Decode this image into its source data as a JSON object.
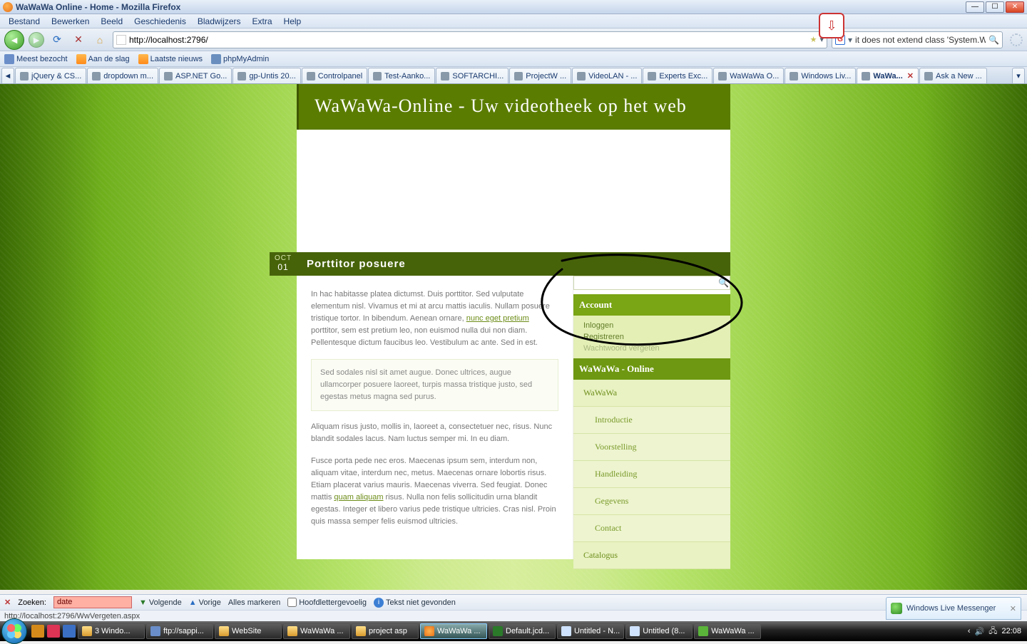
{
  "window": {
    "title": "WaWaWa Online - Home - Mozilla Firefox"
  },
  "menus": {
    "bestand": "Bestand",
    "bewerken": "Bewerken",
    "beeld": "Beeld",
    "geschiedenis": "Geschiedenis",
    "bladwijzers": "Bladwijzers",
    "extra": "Extra",
    "help": "Help"
  },
  "url": "http://localhost:2796/",
  "search_box": "it does not extend class 'System.Web.UI.Page'.",
  "bookmarks": {
    "a": "Meest bezocht",
    "b": "Aan de slag",
    "c": "Laatste nieuws",
    "d": "phpMyAdmin"
  },
  "tabs": [
    {
      "label": "jQuery & CS..."
    },
    {
      "label": "dropdown m..."
    },
    {
      "label": "ASP.NET Go..."
    },
    {
      "label": "gp-Untis 20..."
    },
    {
      "label": "Controlpanel"
    },
    {
      "label": "Test-Aanko..."
    },
    {
      "label": "SOFTARCHI..."
    },
    {
      "label": "ProjectW ..."
    },
    {
      "label": "VideoLAN - ..."
    },
    {
      "label": "Experts Exc..."
    },
    {
      "label": "WaWaWa O..."
    },
    {
      "label": "Windows Liv..."
    },
    {
      "label": "WaWa...",
      "active": true,
      "close": true
    },
    {
      "label": "Ask a New ..."
    }
  ],
  "page": {
    "header": "WaWaWa-Online - Uw videotheek op het web",
    "date_month": "OCT",
    "date_day": "01",
    "post_title": "Porttitor posuere",
    "p1a": "In hac habitasse platea dictumst. Duis porttitor. Sed vulputate elementum nisl. Vivamus et mi at arcu mattis iaculis. Nullam posuere tristique tortor. In bibendum. Aenean ornare, ",
    "p1_link": "nunc eget pretium",
    "p1b": " porttitor, sem est pretium leo, non euismod nulla dui non diam. Pellentesque dictum faucibus leo. Vestibulum ac ante. Sed in est.",
    "callout": "Sed sodales nisl sit amet augue. Donec ultrices, augue ullamcorper posuere laoreet, turpis massa tristique justo, sed egestas metus magna sed purus.",
    "p2": "Aliquam risus justo, mollis in, laoreet a, consectetuer nec, risus. Nunc blandit sodales lacus. Nam luctus semper mi. In eu diam.",
    "p3a": "Fusce porta pede nec eros. Maecenas ipsum sem, interdum non, aliquam vitae, interdum nec, metus. Maecenas ornare lobortis risus. Etiam placerat varius mauris. Maecenas viverra. Sed feugiat. Donec mattis ",
    "p3_link": "quam aliquam",
    "p3b": " risus. Nulla non felis sollicitudin urna blandit egestas. Integer et libero varius pede tristique ultricies. Cras nisl. Proin quis massa semper felis euismod ultricies."
  },
  "sidebar": {
    "account_header": "Account",
    "inloggen": "Inloggen",
    "registreren": "Registreren",
    "vergeten": "Wachtwoord vergeten",
    "site_header": "WaWaWa - Online",
    "items": [
      "WaWaWa",
      "Introductie",
      "Voorstelling",
      "Handleiding",
      "Gegevens",
      "Contact",
      "Catalogus"
    ]
  },
  "findbar": {
    "label": "Zoeken:",
    "value": "date",
    "volgende": "Volgende",
    "vorige": "Vorige",
    "alles": "Alles markeren",
    "hoofd": "Hoofdlettergevoelig",
    "notfound": "Tekst niet gevonden"
  },
  "statusbar": "http://localhost:2796/WwVergeten.aspx",
  "msn": "Windows Live Messenger",
  "taskbar": [
    {
      "label": "3 Windo...",
      "cls": "folder"
    },
    {
      "label": "ftp://sappi...",
      "cls": ""
    },
    {
      "label": "WebSite",
      "cls": "folder"
    },
    {
      "label": "WaWaWa ...",
      "cls": "folder"
    },
    {
      "label": "project asp",
      "cls": "folder"
    },
    {
      "label": "WaWaWa ...",
      "cls": "ff",
      "active": true
    },
    {
      "label": "Default.jcd...",
      "cls": "fw"
    },
    {
      "label": "Untitled - N...",
      "cls": "np"
    },
    {
      "label": "Untitled (8...",
      "cls": "np"
    },
    {
      "label": "WaWaWa ...",
      "cls": "msn"
    }
  ],
  "clock": "22:08"
}
